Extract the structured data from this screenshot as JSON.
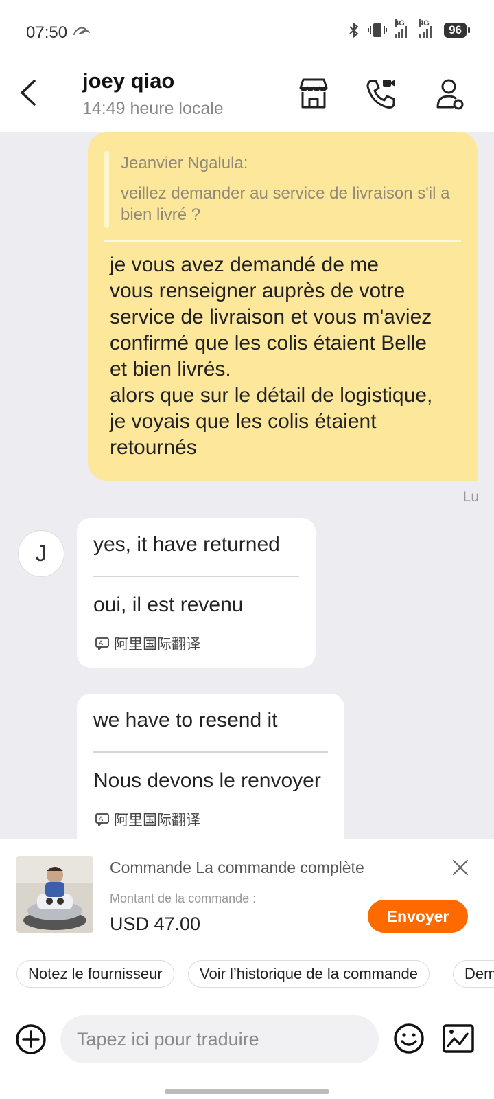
{
  "status_bar": {
    "time": "07:50",
    "network_1": "4G",
    "network_2": "4G",
    "battery": "96"
  },
  "header": {
    "contact_name": "joey qiao",
    "local_time": "14:49 heure locale",
    "icons": [
      "back-icon",
      "store-icon",
      "video-call-icon",
      "user-profile-icon"
    ]
  },
  "messages": {
    "outgoing": {
      "quote_author": "Jeanvier Ngalula:",
      "quote_text": "veillez demander au service de livraison s'il a bien livré ?",
      "text": "je vous avez demandé de me\nvous renseigner auprès de votre\nservice de livraison et vous m'aviez\nconfirmé que les colis étaient Belle\net bien livrés.\nalors que sur le détail de logistique,\nje voyais que les colis étaient\nretournés",
      "status": "Lu"
    },
    "avatar_initial": "J",
    "incoming": [
      {
        "original": "yes, it have returned",
        "translated": "oui, il est revenu",
        "credit": "阿里国际翻译"
      },
      {
        "original": "we have to resend it",
        "translated": "Nous devons le renvoyer",
        "credit": "阿里国际翻译"
      }
    ]
  },
  "order_card": {
    "title": "Commande La commande complète",
    "amount_label": "Montant de la commande :",
    "amount": "USD 47.00",
    "send_label": "Envoyer"
  },
  "quick_actions": [
    "Notez le fournisseur",
    "Voir l’historique de la commande",
    "Dem"
  ],
  "input": {
    "placeholder": "Tapez ici pour traduire"
  },
  "colors": {
    "accent": "#ff6a00",
    "outgoing_bubble": "#fde79b",
    "chat_background": "#ececf1"
  }
}
